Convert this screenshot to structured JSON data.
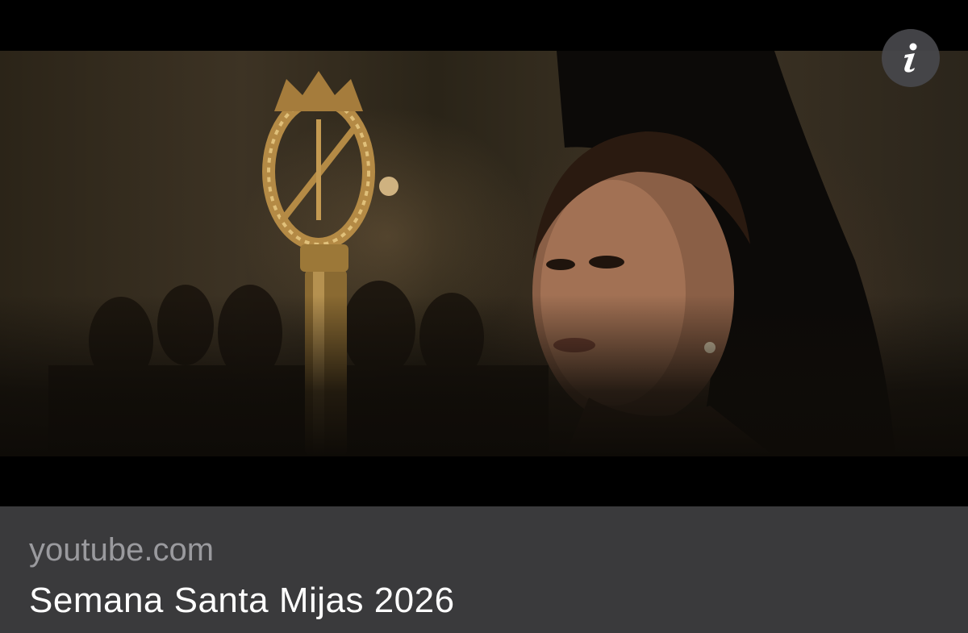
{
  "link_preview": {
    "domain": "youtube.com",
    "title": "Semana Santa Mijas 2026",
    "image_alt": "Young woman in a black mantilla beside an ornate golden processional staff at night"
  },
  "icons": {
    "info": "info-icon"
  },
  "colors": {
    "card_background": "#3a3a3c",
    "domain_text": "#9a9a9e",
    "title_text": "#ffffff",
    "info_button": "#48484c"
  }
}
